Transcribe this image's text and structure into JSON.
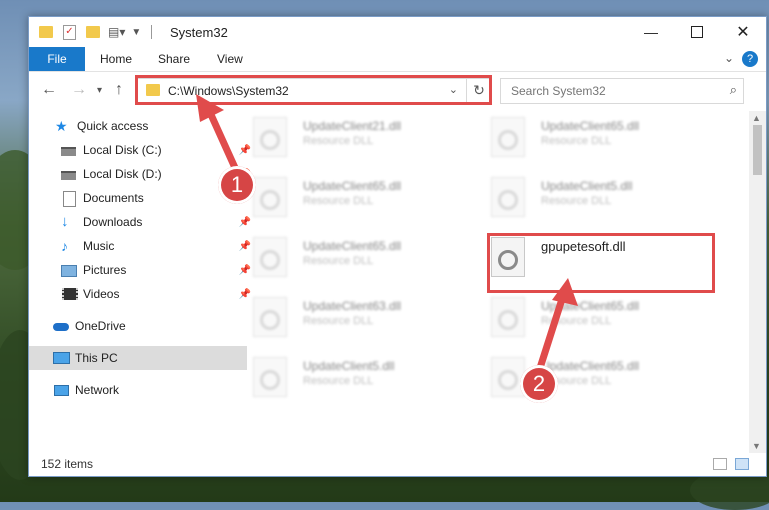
{
  "window": {
    "title": "System32"
  },
  "ribbon": {
    "tabs": [
      {
        "label": "File"
      },
      {
        "label": "Home"
      },
      {
        "label": "Share"
      },
      {
        "label": "View"
      }
    ]
  },
  "navigation": {
    "address": "C:\\Windows\\System32",
    "search_placeholder": "Search System32"
  },
  "sidebar": {
    "items": [
      {
        "label": "Quick access",
        "icon": "star-icon",
        "pinned": false
      },
      {
        "label": "Local Disk (C:)",
        "icon": "drive-icon",
        "pinned": true
      },
      {
        "label": "Local Disk (D:)",
        "icon": "drive-icon",
        "pinned": true
      },
      {
        "label": "Documents",
        "icon": "documents-icon",
        "pinned": true
      },
      {
        "label": "Downloads",
        "icon": "download-icon",
        "pinned": true
      },
      {
        "label": "Music",
        "icon": "music-icon",
        "pinned": true
      },
      {
        "label": "Pictures",
        "icon": "pictures-icon",
        "pinned": true
      },
      {
        "label": "Videos",
        "icon": "video-icon",
        "pinned": true
      },
      {
        "label": "OneDrive",
        "icon": "cloud-icon",
        "pinned": false
      },
      {
        "label": "This PC",
        "icon": "computer-icon",
        "pinned": false,
        "selected": true
      },
      {
        "label": "Network",
        "icon": "network-icon",
        "pinned": false
      }
    ]
  },
  "files": [
    {
      "name": "UpdateClient21.dll",
      "type": "Resource DLL"
    },
    {
      "name": "UpdateClient65.dll",
      "type": "Resource DLL"
    },
    {
      "name": "UpdateClient65.dll",
      "type": "Resource DLL"
    },
    {
      "name": "UpdateClient5.dll",
      "type": "Resource DLL"
    },
    {
      "name": "UpdateClient65.dll",
      "type": "Resource DLL"
    },
    {
      "name": "gpupetesoft.dll",
      "type": ""
    },
    {
      "name": "UpdateClient63.dll",
      "type": "Resource DLL"
    },
    {
      "name": "UpdateClient65.dll",
      "type": "Resource DLL"
    },
    {
      "name": "UpdateClient5.dll",
      "type": "Resource DLL"
    },
    {
      "name": "UpdateClient65.dll",
      "type": "Resource DLL"
    }
  ],
  "status": {
    "item_count": "152 items"
  },
  "annotations": {
    "step1": "1",
    "step2": "2",
    "color": "#e04b4b"
  }
}
